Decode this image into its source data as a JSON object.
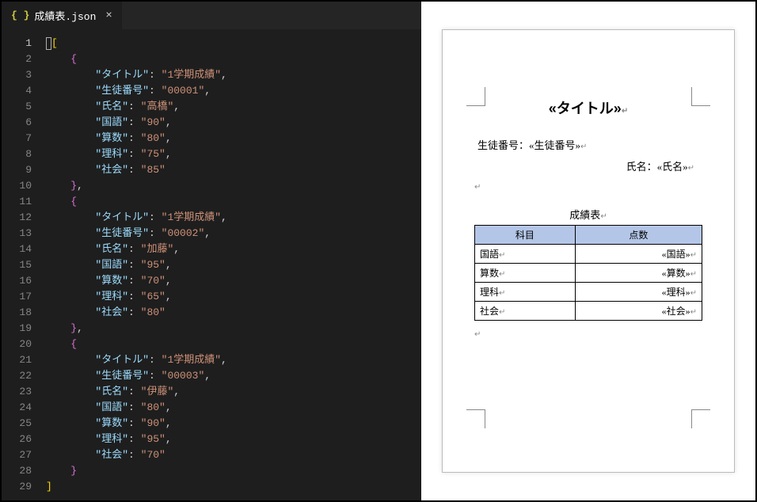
{
  "editor": {
    "tab": {
      "label": "成績表.json",
      "icon": "{ }"
    },
    "lines": [
      {
        "n": 1,
        "type": "text",
        "active": true,
        "cursor": true,
        "indent": 0,
        "bracket": "[",
        "blevel": 1
      },
      {
        "n": 2,
        "type": "text",
        "indent": 1,
        "bracket": "{",
        "blevel": 2
      },
      {
        "n": 3,
        "type": "kv",
        "indent": 2,
        "key": "タイトル",
        "val": "1学期成績",
        "comma": true
      },
      {
        "n": 4,
        "type": "kv",
        "indent": 2,
        "key": "生徒番号",
        "val": "00001",
        "comma": true
      },
      {
        "n": 5,
        "type": "kv",
        "indent": 2,
        "key": "氏名",
        "val": "高橋",
        "comma": true
      },
      {
        "n": 6,
        "type": "kv",
        "indent": 2,
        "key": "国語",
        "val": "90",
        "comma": true
      },
      {
        "n": 7,
        "type": "kv",
        "indent": 2,
        "key": "算数",
        "val": "80",
        "comma": true
      },
      {
        "n": 8,
        "type": "kv",
        "indent": 2,
        "key": "理科",
        "val": "75",
        "comma": true
      },
      {
        "n": 9,
        "type": "kv",
        "indent": 2,
        "key": "社会",
        "val": "85",
        "comma": false
      },
      {
        "n": 10,
        "type": "text",
        "indent": 1,
        "bracket": "}",
        "blevel": 2,
        "after": ","
      },
      {
        "n": 11,
        "type": "text",
        "indent": 1,
        "bracket": "{",
        "blevel": 2
      },
      {
        "n": 12,
        "type": "kv",
        "indent": 2,
        "key": "タイトル",
        "val": "1学期成績",
        "comma": true
      },
      {
        "n": 13,
        "type": "kv",
        "indent": 2,
        "key": "生徒番号",
        "val": "00002",
        "comma": true
      },
      {
        "n": 14,
        "type": "kv",
        "indent": 2,
        "key": "氏名",
        "val": "加藤",
        "comma": true
      },
      {
        "n": 15,
        "type": "kv",
        "indent": 2,
        "key": "国語",
        "val": "95",
        "comma": true
      },
      {
        "n": 16,
        "type": "kv",
        "indent": 2,
        "key": "算数",
        "val": "70",
        "comma": true
      },
      {
        "n": 17,
        "type": "kv",
        "indent": 2,
        "key": "理科",
        "val": "65",
        "comma": true
      },
      {
        "n": 18,
        "type": "kv",
        "indent": 2,
        "key": "社会",
        "val": "80",
        "comma": false
      },
      {
        "n": 19,
        "type": "text",
        "indent": 1,
        "bracket": "}",
        "blevel": 2,
        "after": ","
      },
      {
        "n": 20,
        "type": "text",
        "indent": 1,
        "bracket": "{",
        "blevel": 2
      },
      {
        "n": 21,
        "type": "kv",
        "indent": 2,
        "key": "タイトル",
        "val": "1学期成績",
        "comma": true
      },
      {
        "n": 22,
        "type": "kv",
        "indent": 2,
        "key": "生徒番号",
        "val": "00003",
        "comma": true
      },
      {
        "n": 23,
        "type": "kv",
        "indent": 2,
        "key": "氏名",
        "val": "伊藤",
        "comma": true
      },
      {
        "n": 24,
        "type": "kv",
        "indent": 2,
        "key": "国語",
        "val": "80",
        "comma": true
      },
      {
        "n": 25,
        "type": "kv",
        "indent": 2,
        "key": "算数",
        "val": "90",
        "comma": true
      },
      {
        "n": 26,
        "type": "kv",
        "indent": 2,
        "key": "理科",
        "val": "95",
        "comma": true
      },
      {
        "n": 27,
        "type": "kv",
        "indent": 2,
        "key": "社会",
        "val": "70",
        "comma": false
      },
      {
        "n": 28,
        "type": "text",
        "indent": 1,
        "bracket": "}",
        "blevel": 2
      },
      {
        "n": 29,
        "type": "text",
        "indent": 0,
        "bracket": "]",
        "blevel": 1
      }
    ]
  },
  "document": {
    "title": "«タイトル»",
    "line1_label": "生徒番号：",
    "line1_field": "«生徒番号»",
    "line2_label": "氏名：",
    "line2_field": "«氏名»",
    "table_title": "成績表",
    "headers": {
      "subject": "科目",
      "score": "点数"
    },
    "rows": [
      {
        "subject": "国語",
        "field": "«国語»"
      },
      {
        "subject": "算数",
        "field": "«算数»"
      },
      {
        "subject": "理科",
        "field": "«理科»"
      },
      {
        "subject": "社会",
        "field": "«社会»"
      }
    ]
  }
}
